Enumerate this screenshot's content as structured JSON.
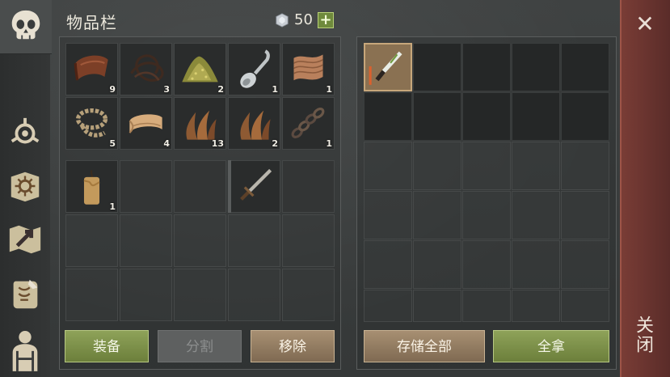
{
  "header": {
    "title": "物品栏",
    "currency_amount": "50",
    "plus_label": "+"
  },
  "sidebar": {
    "icons": [
      "skull-icon",
      "crafting-icon",
      "journal-icon",
      "map-icon",
      "quest-scroll-icon",
      "character-icon"
    ]
  },
  "inventory": {
    "items_row1": [
      {
        "name": "leather",
        "icon": "leather-icon",
        "qty": "9"
      },
      {
        "name": "sinew",
        "icon": "sinew-icon",
        "qty": "3"
      },
      {
        "name": "dust",
        "icon": "dust-pile-icon",
        "qty": "2"
      },
      {
        "name": "spoon",
        "icon": "spoon-icon",
        "qty": "1"
      },
      {
        "name": "cloth",
        "icon": "cloth-icon",
        "qty": "1"
      }
    ],
    "items_row2": [
      {
        "name": "rope",
        "icon": "rope-icon",
        "qty": "5"
      },
      {
        "name": "fabric",
        "icon": "fabric-icon",
        "qty": "4"
      },
      {
        "name": "fiber",
        "icon": "fiber-icon",
        "qty": "13"
      },
      {
        "name": "fiber",
        "icon": "fiber-icon",
        "qty": "2"
      },
      {
        "name": "chain",
        "icon": "chain-icon",
        "qty": "1"
      }
    ],
    "hotbar": [
      {
        "name": "candle",
        "icon": "candle-icon",
        "qty": "1"
      },
      {
        "name": "sword",
        "icon": "sword-icon",
        "qty": ""
      }
    ]
  },
  "storage": {
    "items": [
      {
        "name": "knife",
        "icon": "knife-icon"
      }
    ]
  },
  "buttons": {
    "equip": "装备",
    "split": "分割",
    "remove": "移除",
    "store_all": "存储全部",
    "take_all": "全拿",
    "close": "关闭"
  },
  "colors": {
    "green_button": "#7d9149",
    "tan_button": "#93806a",
    "close_strip": "#6b3530"
  }
}
